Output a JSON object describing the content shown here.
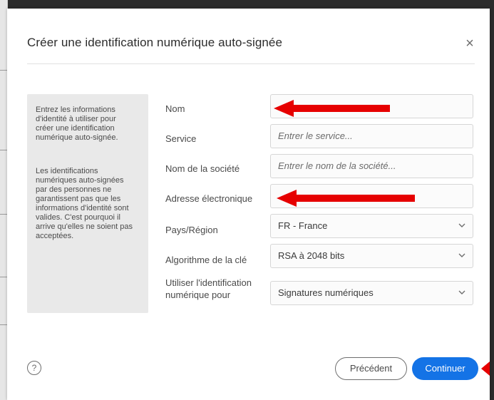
{
  "dialog": {
    "title": "Créer une identification numérique auto-signée",
    "close_label": "×"
  },
  "info": {
    "paragraph1_lines": [
      "Entrez les informations",
      "d'identité à utiliser pour",
      "créer une identification",
      "numérique auto-signée."
    ],
    "paragraph2_lines": [
      "Les identifications",
      "numériques auto-signées",
      "par des personnes ne",
      "garantissent pas que les",
      "informations d'identité sont",
      "valides. C'est pourquoi il",
      "arrive qu'elles ne soient pas",
      "acceptées."
    ]
  },
  "form": {
    "name": {
      "label": "Nom",
      "value": ""
    },
    "service": {
      "label": "Service",
      "placeholder": "Entrer le service..."
    },
    "company": {
      "label": "Nom de la société",
      "placeholder": "Entrer le nom de la société..."
    },
    "email": {
      "label": "Adresse électronique",
      "value": ""
    },
    "country": {
      "label": "Pays/Région",
      "selected": "FR - France"
    },
    "key_algorithm": {
      "label": "Algorithme de la clé",
      "selected": "RSA à 2048 bits"
    },
    "usage": {
      "label_lines": [
        "Utiliser l'identification",
        "numérique pour"
      ],
      "selected": "Signatures numériques"
    }
  },
  "footer": {
    "help_label": "?",
    "previous_label": "Précédent",
    "continue_label": "Continuer"
  },
  "colors": {
    "primary_button": "#1473e6",
    "annotation_arrow": "#e60000",
    "info_panel": "#e9e9e9"
  },
  "icons": {
    "close": "close-icon",
    "help": "help-icon",
    "dropdown": "chevron-down-icon",
    "annotation": "red-arrow"
  }
}
